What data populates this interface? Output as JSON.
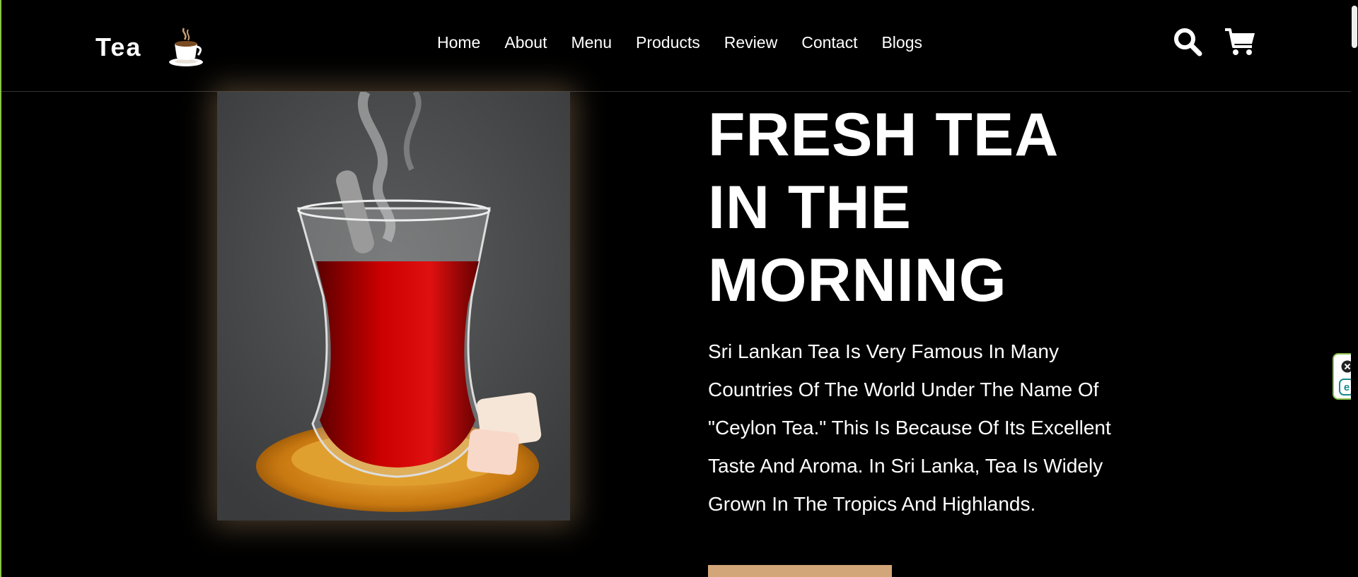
{
  "header": {
    "logo_text": "Tea",
    "logo_icon": "coffee-cup-icon",
    "nav": [
      "Home",
      "About",
      "Menu",
      "Products",
      "Review",
      "Contact",
      "Blogs"
    ],
    "icons": [
      "search-icon",
      "shopping-cart-icon"
    ]
  },
  "hero": {
    "title_lines": [
      "FRESH TEA",
      "IN THE",
      "MORNING"
    ],
    "description": "Sri Lankan Tea Is Very Famous In Many Countries Of The World Under The Name Of \"Ceylon Tea.\" This Is Because Of Its Excellent Taste And Aroma. In Sri Lanka, Tea Is Widely Grown In The Tropics And Highlands.",
    "button_color": "#d2a679"
  },
  "side_widget": {
    "icons": [
      "close-icon",
      "extension-e-icon"
    ]
  },
  "colors": {
    "background": "#000000",
    "text": "#ffffff",
    "accent": "#d2a679",
    "frame_border": "#8bc34a"
  }
}
